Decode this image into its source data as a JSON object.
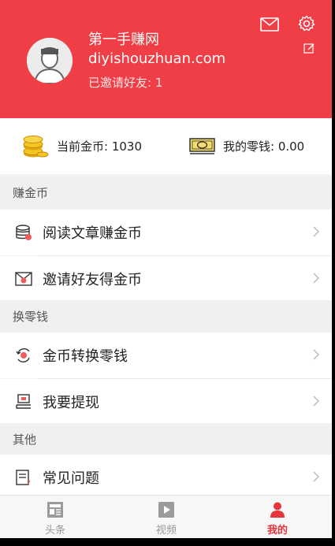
{
  "header": {
    "username": "第一手赚网",
    "site": "diyishouzhuan.com",
    "invited": "已邀请好友: 1",
    "icons": [
      "mail-icon",
      "gear-icon",
      "edit-icon"
    ]
  },
  "stats": {
    "coins_label": "当前金币: 1030",
    "change_label": "我的零钱: 0.00"
  },
  "sections": {
    "earn_title": "赚金币",
    "earn_items": [
      {
        "label": "阅读文章赚金币",
        "icon": "coins-stack-icon"
      },
      {
        "label": "邀请好友得金币",
        "icon": "envelope-invite-icon"
      }
    ],
    "exchange_title": "换零钱",
    "exchange_items": [
      {
        "label": "金币转换零钱",
        "icon": "exchange-icon"
      },
      {
        "label": "我要提现",
        "icon": "withdraw-icon"
      }
    ],
    "other_title": "其他",
    "other_items": [
      {
        "label": "常见问题",
        "icon": "faq-icon"
      }
    ]
  },
  "tabs": [
    {
      "label": "头条",
      "icon": "news-icon",
      "active": false
    },
    {
      "label": "视频",
      "icon": "video-icon",
      "active": false
    },
    {
      "label": "我的",
      "icon": "profile-icon",
      "active": true
    }
  ],
  "colors": {
    "brand": "#ef3e45",
    "active_tab": "#e5343b",
    "coin_gold": "#f3c623",
    "cash_green": "#e8c84a"
  }
}
